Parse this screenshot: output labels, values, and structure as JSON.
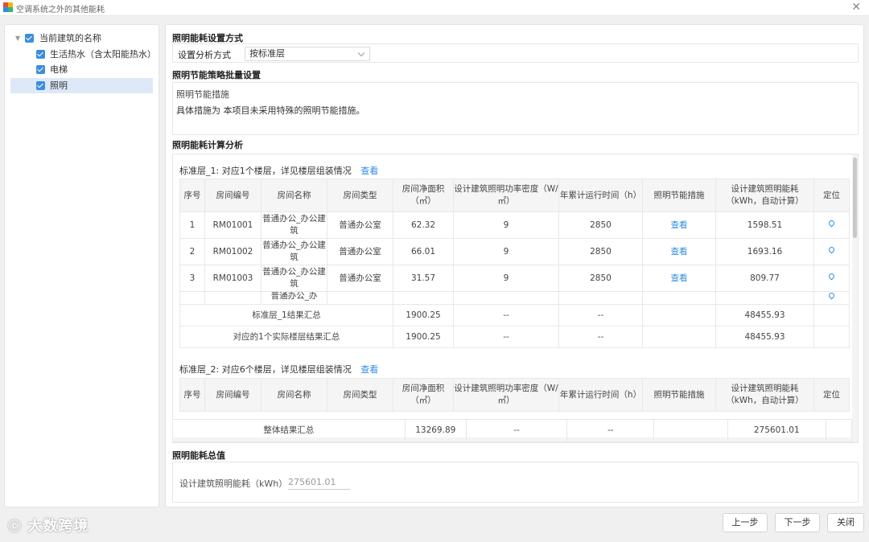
{
  "window": {
    "title": "空调系统之外的其他能耗"
  },
  "tree": {
    "root": "当前建筑的名称",
    "items": [
      "生活热水（含太阳能热水）",
      "电梯",
      "照明"
    ]
  },
  "settings": {
    "title": "照明能耗设置方式",
    "method_label": "设置分析方式",
    "method_value": "按标准层"
  },
  "strategy": {
    "title": "照明节能策略批量设置",
    "sub_title": "照明节能措施",
    "text": "具体措施为 本项目未采用特殊的照明节能措施。"
  },
  "analysis": {
    "title": "照明能耗计算分析",
    "columns": [
      "序号",
      "房间编号",
      "房间名称",
      "房间类型",
      "房间净面积（㎡）",
      "设计建筑照明功率密度（W/㎡）",
      "年累计运行时间（h）",
      "照明节能措施",
      "设计建筑照明能耗（kWh，自动计算）",
      "定位"
    ],
    "groups": [
      {
        "title": "标准层_1: 对应1个楼层，详见楼层组装情况",
        "link": "查看",
        "rows": [
          {
            "no": "1",
            "code": "RM01001",
            "name": "普通办公_办公建筑",
            "type": "普通办公室",
            "area": "62.32",
            "density": "9",
            "hours": "2850",
            "measure": "查看",
            "energy": "1598.51"
          },
          {
            "no": "2",
            "code": "RM01002",
            "name": "普通办公_办公建筑",
            "type": "普通办公室",
            "area": "66.01",
            "density": "9",
            "hours": "2850",
            "measure": "查看",
            "energy": "1693.16"
          },
          {
            "no": "3",
            "code": "RM01003",
            "name": "普通办公_办公建筑",
            "type": "普通办公室",
            "area": "31.57",
            "density": "9",
            "hours": "2850",
            "measure": "查看",
            "energy": "809.77"
          }
        ],
        "partial_row_text": "普通办公_办",
        "summary": [
          {
            "label": "标准层_1结果汇总",
            "area": "1900.25",
            "density": "--",
            "hours": "--",
            "energy": "48455.93"
          },
          {
            "label": "对应的1个实际楼层结果汇总",
            "area": "1900.25",
            "density": "--",
            "hours": "--",
            "energy": "48455.93"
          }
        ]
      },
      {
        "title": "标准层_2: 对应6个楼层，详见楼层组装情况",
        "link": "查看"
      }
    ],
    "total": {
      "label": "整体结果汇总",
      "area": "13269.89",
      "density": "--",
      "hours": "--",
      "energy": "275601.01"
    }
  },
  "total_energy": {
    "title": "照明能耗总值",
    "label": "设计建筑照明能耗（kWh）",
    "value": "275601.01"
  },
  "buttons": {
    "prev": "上一步",
    "next": "下一步",
    "close": "关闭"
  },
  "watermark": "大数跨境"
}
